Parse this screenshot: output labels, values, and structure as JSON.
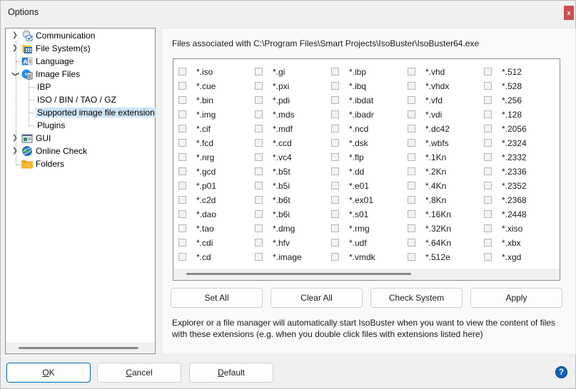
{
  "window": {
    "title": "Options",
    "close_label": "x"
  },
  "tree": {
    "items": [
      {
        "label": "Communication",
        "icon": "gear-icon",
        "expandable": true,
        "expanded": false,
        "level": 0
      },
      {
        "label": "File System(s)",
        "icon": "folder-grid-icon",
        "expandable": true,
        "expanded": false,
        "level": 0
      },
      {
        "label": "Language",
        "icon": "language-icon",
        "expandable": false,
        "level": 0
      },
      {
        "label": "Image Files",
        "icon": "image-file-icon",
        "expandable": true,
        "expanded": true,
        "level": 0
      },
      {
        "label": "IBP",
        "level": 1
      },
      {
        "label": "ISO / BIN / TAO / GZ",
        "level": 1
      },
      {
        "label": "Supported image file extension",
        "level": 1,
        "selected": true
      },
      {
        "label": "Plugins",
        "level": 1
      },
      {
        "label": "GUI",
        "icon": "window-icon",
        "expandable": true,
        "expanded": false,
        "level": 0
      },
      {
        "label": "Online Check",
        "icon": "globe-icon",
        "expandable": true,
        "expanded": false,
        "level": 0
      },
      {
        "label": "Folders",
        "icon": "folder-icon",
        "expandable": false,
        "level": 0
      }
    ]
  },
  "main": {
    "assoc_label": "Files associated with C:\\Program Files\\Smart Projects\\IsoBuster\\IsoBuster64.exe",
    "extension_columns": [
      [
        "*.iso",
        "*.cue",
        "*.bin",
        "*.img",
        "*.cif",
        "*.fcd",
        "*.nrg",
        "*.gcd",
        "*.p01",
        "*.c2d",
        "*.dao",
        "*.tao",
        "*.cdi",
        "*.cd"
      ],
      [
        "*.gi",
        "*.pxi",
        "*.pdi",
        "*.mds",
        "*.mdf",
        "*.ccd",
        "*.vc4",
        "*.b5t",
        "*.b5i",
        "*.b6t",
        "*.b6i",
        "*.dmg",
        "*.hfv",
        "*.image"
      ],
      [
        "*.ibp",
        "*.ibq",
        "*.ibdat",
        "*.ibadr",
        "*.ncd",
        "*.dsk",
        "*.flp",
        "*.dd",
        "*.e01",
        "*.ex01",
        "*.s01",
        "*.rmg",
        "*.udf",
        "*.vmdk"
      ],
      [
        "*.vhd",
        "*.vhdx",
        "*.vfd",
        "*.vdi",
        "*.dc42",
        "*.wbfs",
        "*.1Kn",
        "*.2Kn",
        "*.4Kn",
        "*.8Kn",
        "*.16Kn",
        "*.32Kn",
        "*.64Kn",
        "*.512e"
      ],
      [
        "*.512",
        "*.528",
        "*.256",
        "*.128",
        "*.2056",
        "*.2324",
        "*.2332",
        "*.2336",
        "*.2352",
        "*.2368",
        "*.2448",
        "*.xiso",
        "*.xbx",
        "*.xgd"
      ]
    ],
    "all_checked": false,
    "buttons": {
      "set_all": "Set All",
      "clear_all": "Clear All",
      "check_system": "Check System",
      "apply": "Apply"
    },
    "info_text": "Explorer or a file manager will automatically start IsoBuster when you want to view the content of files with these extensions (e.g. when you double click files with extensions listed here)"
  },
  "footer": {
    "ok_label": "OK",
    "ok_mnemonic": "O",
    "ok_rest": "K",
    "cancel_mnemonic": "C",
    "cancel_rest": "ancel",
    "default_mnemonic": "D",
    "default_rest": "efault",
    "help_label": "?"
  }
}
